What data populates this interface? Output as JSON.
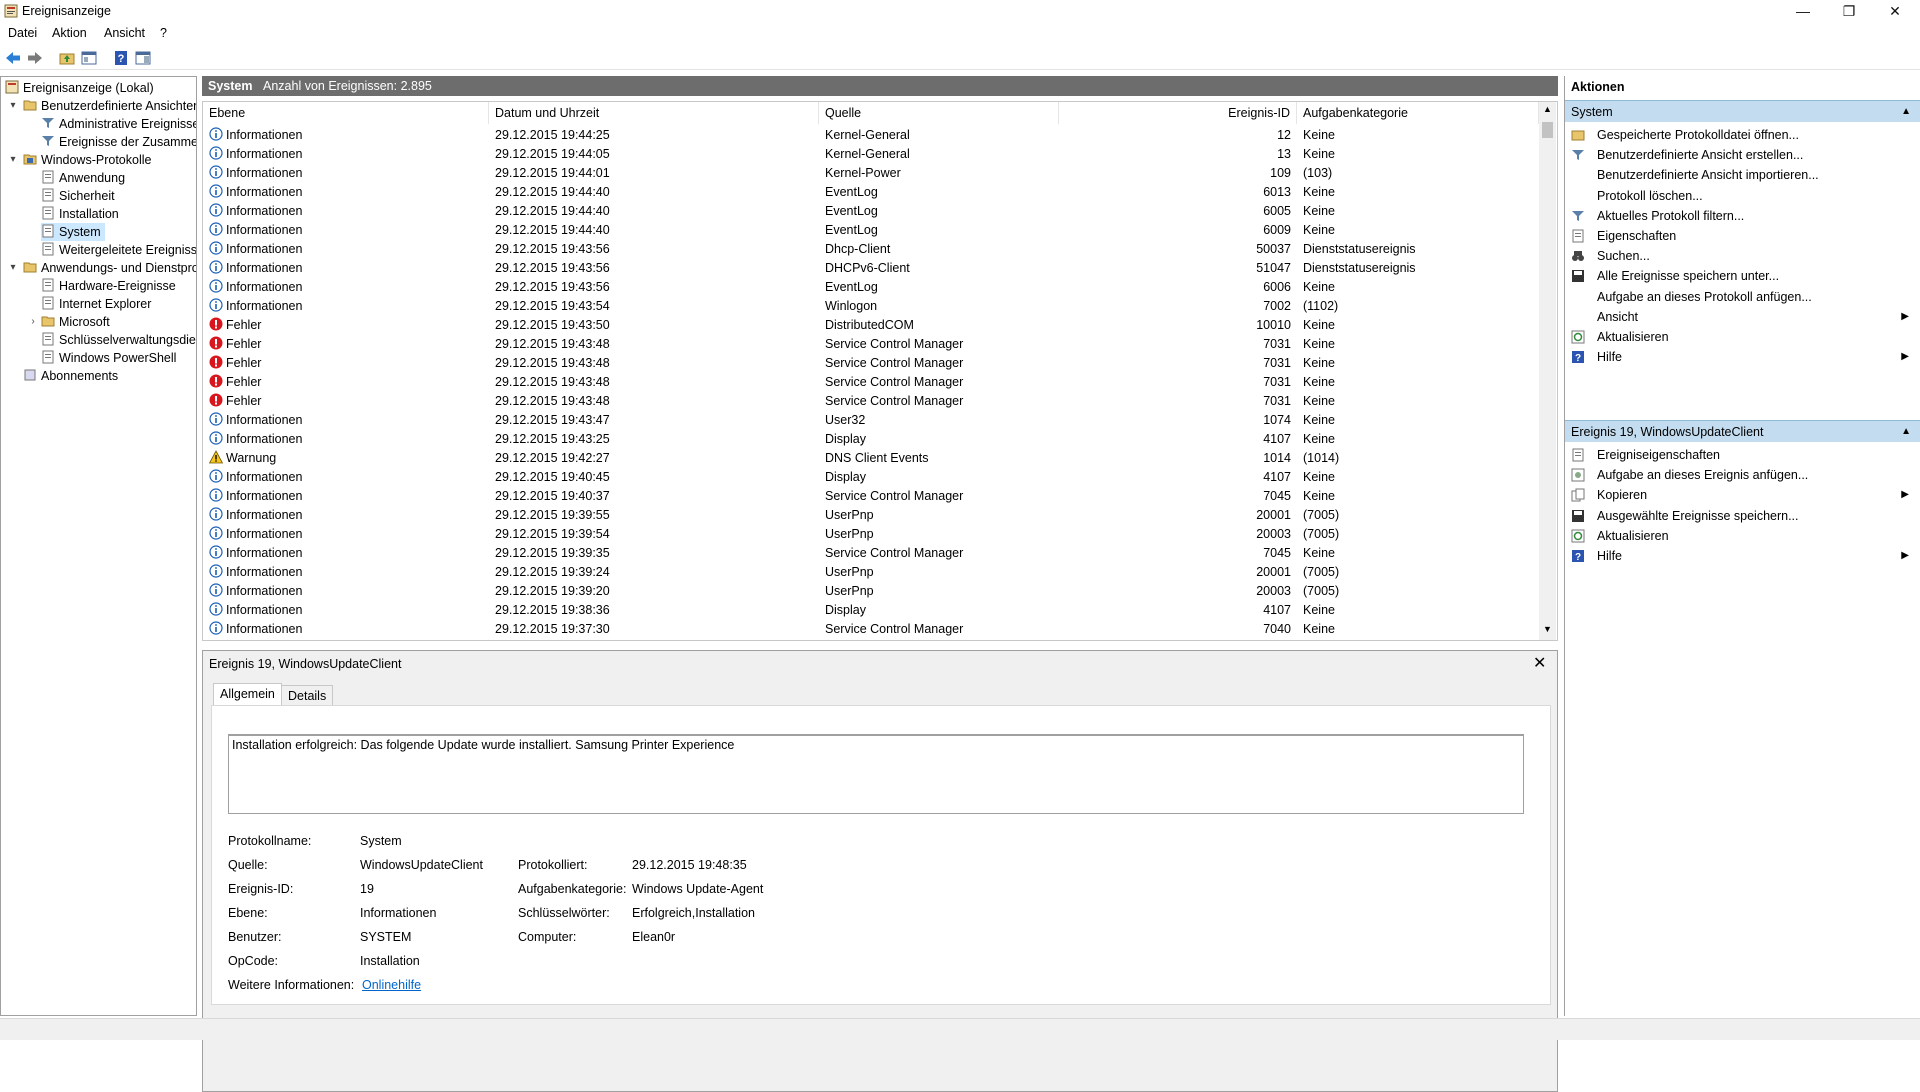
{
  "window": {
    "title": "Ereignisanzeige",
    "controls": {
      "minimize": "—",
      "maximize": "❐",
      "close": "✕"
    }
  },
  "menu": [
    "Datei",
    "Aktion",
    "Ansicht",
    "?"
  ],
  "toolbar": [
    "back-icon",
    "forward-icon",
    "folder-up-icon",
    "console-tree-icon",
    "help-icon",
    "action-pane-icon"
  ],
  "tree": {
    "root": "Ereignisanzeige (Lokal)",
    "items": [
      {
        "label": "Benutzerdefinierte Ansichten",
        "expander": "▾"
      },
      {
        "label": "Administrative Ereignisse"
      },
      {
        "label": "Ereignisse der Zusammen"
      },
      {
        "label": "Windows-Protokolle",
        "expander": "▾"
      },
      {
        "label": "Anwendung"
      },
      {
        "label": "Sicherheit"
      },
      {
        "label": "Installation"
      },
      {
        "label": "System"
      },
      {
        "label": "Weitergeleitete Ereignisse"
      },
      {
        "label": "Anwendungs- und Dienstprotokolle",
        "expander": "▾"
      },
      {
        "label": "Hardware-Ereignisse"
      },
      {
        "label": "Internet Explorer"
      },
      {
        "label": "Microsoft",
        "expander": "›"
      },
      {
        "label": "Schlüsselverwaltungsdienst"
      },
      {
        "label": "Windows PowerShell"
      },
      {
        "label": "Abonnements"
      }
    ]
  },
  "center_header": {
    "log_name": "System",
    "count_text": "Anzahl von Ereignissen: 2.895"
  },
  "grid": {
    "columns": [
      "Ebene",
      "Datum und Uhrzeit",
      "Quelle",
      "Ereignis-ID",
      "Aufgabenkategorie"
    ],
    "rows": [
      {
        "level": "Informationen",
        "type": "info",
        "date": "29.12.2015 19:44:25",
        "source": "Kernel-General",
        "id": "12",
        "category": "Keine"
      },
      {
        "level": "Informationen",
        "type": "info",
        "date": "29.12.2015 19:44:05",
        "source": "Kernel-General",
        "id": "13",
        "category": "Keine"
      },
      {
        "level": "Informationen",
        "type": "info",
        "date": "29.12.2015 19:44:01",
        "source": "Kernel-Power",
        "id": "109",
        "category": "(103)"
      },
      {
        "level": "Informationen",
        "type": "info",
        "date": "29.12.2015 19:44:40",
        "source": "EventLog",
        "id": "6013",
        "category": "Keine"
      },
      {
        "level": "Informationen",
        "type": "info",
        "date": "29.12.2015 19:44:40",
        "source": "EventLog",
        "id": "6005",
        "category": "Keine"
      },
      {
        "level": "Informationen",
        "type": "info",
        "date": "29.12.2015 19:44:40",
        "source": "EventLog",
        "id": "6009",
        "category": "Keine"
      },
      {
        "level": "Informationen",
        "type": "info",
        "date": "29.12.2015 19:43:56",
        "source": "Dhcp-Client",
        "id": "50037",
        "category": "Dienststatusereignis"
      },
      {
        "level": "Informationen",
        "type": "info",
        "date": "29.12.2015 19:43:56",
        "source": "DHCPv6-Client",
        "id": "51047",
        "category": "Dienststatusereignis"
      },
      {
        "level": "Informationen",
        "type": "info",
        "date": "29.12.2015 19:43:56",
        "source": "EventLog",
        "id": "6006",
        "category": "Keine"
      },
      {
        "level": "Informationen",
        "type": "info",
        "date": "29.12.2015 19:43:54",
        "source": "Winlogon",
        "id": "7002",
        "category": "(1102)"
      },
      {
        "level": "Fehler",
        "type": "error",
        "date": "29.12.2015 19:43:50",
        "source": "DistributedCOM",
        "id": "10010",
        "category": "Keine"
      },
      {
        "level": "Fehler",
        "type": "error",
        "date": "29.12.2015 19:43:48",
        "source": "Service Control Manager",
        "id": "7031",
        "category": "Keine"
      },
      {
        "level": "Fehler",
        "type": "error",
        "date": "29.12.2015 19:43:48",
        "source": "Service Control Manager",
        "id": "7031",
        "category": "Keine"
      },
      {
        "level": "Fehler",
        "type": "error",
        "date": "29.12.2015 19:43:48",
        "source": "Service Control Manager",
        "id": "7031",
        "category": "Keine"
      },
      {
        "level": "Fehler",
        "type": "error",
        "date": "29.12.2015 19:43:48",
        "source": "Service Control Manager",
        "id": "7031",
        "category": "Keine"
      },
      {
        "level": "Informationen",
        "type": "info",
        "date": "29.12.2015 19:43:47",
        "source": "User32",
        "id": "1074",
        "category": "Keine"
      },
      {
        "level": "Informationen",
        "type": "info",
        "date": "29.12.2015 19:43:25",
        "source": "Display",
        "id": "4107",
        "category": "Keine"
      },
      {
        "level": "Warnung",
        "type": "warning",
        "date": "29.12.2015 19:42:27",
        "source": "DNS Client Events",
        "id": "1014",
        "category": "(1014)"
      },
      {
        "level": "Informationen",
        "type": "info",
        "date": "29.12.2015 19:40:45",
        "source": "Display",
        "id": "4107",
        "category": "Keine"
      },
      {
        "level": "Informationen",
        "type": "info",
        "date": "29.12.2015 19:40:37",
        "source": "Service Control Manager",
        "id": "7045",
        "category": "Keine"
      },
      {
        "level": "Informationen",
        "type": "info",
        "date": "29.12.2015 19:39:55",
        "source": "UserPnp",
        "id": "20001",
        "category": "(7005)"
      },
      {
        "level": "Informationen",
        "type": "info",
        "date": "29.12.2015 19:39:54",
        "source": "UserPnp",
        "id": "20003",
        "category": "(7005)"
      },
      {
        "level": "Informationen",
        "type": "info",
        "date": "29.12.2015 19:39:35",
        "source": "Service Control Manager",
        "id": "7045",
        "category": "Keine"
      },
      {
        "level": "Informationen",
        "type": "info",
        "date": "29.12.2015 19:39:24",
        "source": "UserPnp",
        "id": "20001",
        "category": "(7005)"
      },
      {
        "level": "Informationen",
        "type": "info",
        "date": "29.12.2015 19:39:20",
        "source": "UserPnp",
        "id": "20003",
        "category": "(7005)"
      },
      {
        "level": "Informationen",
        "type": "info",
        "date": "29.12.2015 19:38:36",
        "source": "Display",
        "id": "4107",
        "category": "Keine"
      },
      {
        "level": "Informationen",
        "type": "info",
        "date": "29.12.2015 19:37:30",
        "source": "Service Control Manager",
        "id": "7040",
        "category": "Keine"
      }
    ]
  },
  "detail": {
    "title": "Ereignis 19, WindowsUpdateClient",
    "tabs": [
      "Allgemein",
      "Details"
    ],
    "description": "Installation erfolgreich: Das folgende Update wurde installiert. Samsung Printer Experience",
    "fields": {
      "protokollname_label": "Protokollname:",
      "protokollname": "System",
      "quelle_label": "Quelle:",
      "quelle": "WindowsUpdateClient",
      "protokolliert_label": "Protokolliert:",
      "protokolliert": "29.12.2015 19:48:35",
      "ereignis_id_label": "Ereignis-ID:",
      "ereignis_id": "19",
      "aufgabenkategorie_label": "Aufgabenkategorie:",
      "aufgabenkategorie": "Windows Update-Agent",
      "ebene_label": "Ebene:",
      "ebene": "Informationen",
      "schluesselwoerter_label": "Schlüsselwörter:",
      "schluesselwoerter": "Erfolgreich,Installation",
      "benutzer_label": "Benutzer:",
      "benutzer": "SYSTEM",
      "computer_label": "Computer:",
      "computer": "Elean0r",
      "opcode_label": "OpCode:",
      "opcode": "Installation",
      "weitere_label": "Weitere Informationen:",
      "weitere_link": "Onlinehilfe"
    }
  },
  "actions": {
    "title": "Aktionen",
    "section1": "System",
    "items1": [
      {
        "label": "Gespeicherte Protokolldatei öffnen...",
        "icon": "open-folder-icon"
      },
      {
        "label": "Benutzerdefinierte Ansicht erstellen...",
        "icon": "filter-icon"
      },
      {
        "label": "Benutzerdefinierte Ansicht importieren...",
        "icon": ""
      },
      {
        "label": "Protokoll löschen...",
        "icon": ""
      },
      {
        "label": "Aktuelles Protokoll filtern...",
        "icon": "filter-icon"
      },
      {
        "label": "Eigenschaften",
        "icon": "properties-icon"
      },
      {
        "label": "Suchen...",
        "icon": "binoculars-icon"
      },
      {
        "label": "Alle Ereignisse speichern unter...",
        "icon": "save-icon"
      },
      {
        "label": "Aufgabe an dieses Protokoll anfügen...",
        "icon": ""
      },
      {
        "label": "Ansicht",
        "icon": "",
        "submenu": "▶"
      },
      {
        "label": "Aktualisieren",
        "icon": "refresh-icon"
      },
      {
        "label": "Hilfe",
        "icon": "help-icon",
        "submenu": "▶"
      }
    ],
    "section2": "Ereignis 19, WindowsUpdateClient",
    "items2": [
      {
        "label": "Ereigniseigenschaften",
        "icon": "properties-icon"
      },
      {
        "label": "Aufgabe an dieses Ereignis anfügen...",
        "icon": "task-icon"
      },
      {
        "label": "Kopieren",
        "icon": "copy-icon",
        "submenu": "▶"
      },
      {
        "label": "Ausgewählte Ereignisse speichern...",
        "icon": "save-icon"
      },
      {
        "label": "Aktualisieren",
        "icon": "refresh-icon"
      },
      {
        "label": "Hilfe",
        "icon": "help-icon",
        "submenu": "▶"
      }
    ],
    "collapse_arrow": "▲"
  },
  "colors": {
    "header_gray": "#6d6d6d",
    "selection_blue": "#cce8ff",
    "section_blue": "#c3dcef",
    "info_blue": "#1c5fb5",
    "error_red": "#d9161d",
    "warning_yellow": "#f5c51a"
  }
}
